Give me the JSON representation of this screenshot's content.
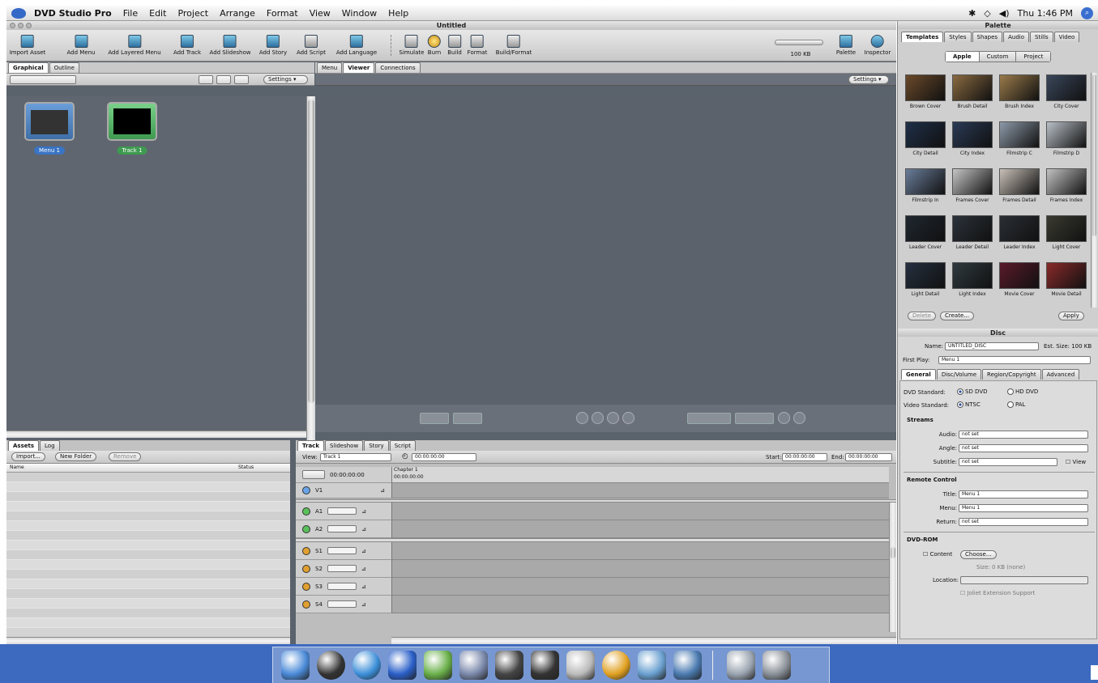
{
  "menubar": {
    "app_name": "DVD Studio Pro",
    "items": [
      "File",
      "Edit",
      "Project",
      "Arrange",
      "Format",
      "View",
      "Window",
      "Help"
    ],
    "clock": "Thu 1:46 PM"
  },
  "window": {
    "title": "Untitled"
  },
  "toolbar": {
    "items": [
      "Import Asset",
      "Add Menu",
      "Add Layered Menu",
      "Add Track",
      "Add Slideshow",
      "Add Story",
      "Add Script",
      "Add Language",
      "Simulate",
      "Burn",
      "Build",
      "Format",
      "Build/Format",
      "Palette",
      "Inspector"
    ],
    "disk_size": "100 KB"
  },
  "left_tabs": {
    "graphical": "Graphical",
    "outline": "Outline"
  },
  "left_subbar": {
    "settings": "Settings"
  },
  "graphical_items": [
    {
      "label": "Menu 1",
      "type": "menu",
      "accent": "#5a8fc8"
    },
    {
      "label": "Track 1",
      "type": "track",
      "accent": "#4fae5a"
    }
  ],
  "viewer_tabs": {
    "menu": "Menu",
    "viewer": "Viewer",
    "connections": "Connections"
  },
  "viewer_settings": "Settings",
  "bottom_left_tabs": {
    "assets": "Assets",
    "log": "Log"
  },
  "assets": {
    "import_btn": "Import...",
    "new_folder_btn": "New Folder",
    "remove_btn": "Remove",
    "col_name": "Name",
    "col_status": "Status"
  },
  "timeline_tabs": {
    "track": "Track",
    "slideshow": "Slideshow",
    "story": "Story",
    "script": "Script"
  },
  "timeline": {
    "view_label": "View:",
    "view_value": "Track 1",
    "timecode": "00:00:00:00",
    "start_label": "Start:",
    "start_value": "00:00:00:00",
    "end_label": "End:",
    "end_value": "00:00:00:00",
    "chapter_label": "Chapter 1",
    "chapter_time": "00:00:00:00",
    "head_time": "00:00:00:00",
    "tracks": [
      "V1",
      "A1",
      "A2",
      "S1",
      "S2",
      "S3",
      "S4"
    ]
  },
  "palette": {
    "title": "Palette",
    "tabs": [
      "Templates",
      "Styles",
      "Shapes",
      "Audio",
      "Stills",
      "Video"
    ],
    "subtabs": [
      "Apple",
      "Custom",
      "Project"
    ],
    "templates": [
      {
        "name": "Brown Cover",
        "color": "#6b4a2a"
      },
      {
        "name": "Brush Detail",
        "color": "#8a6a40"
      },
      {
        "name": "Brush Index",
        "color": "#9a7a4a"
      },
      {
        "name": "City Cover",
        "color": "#39465a"
      },
      {
        "name": "City Detail",
        "color": "#1f3048"
      },
      {
        "name": "City Index",
        "color": "#2a3a55"
      },
      {
        "name": "Filmstrip C",
        "color": "#8d9aa8"
      },
      {
        "name": "Filmstrip D",
        "color": "#b9c0c8"
      },
      {
        "name": "Filmstrip In",
        "color": "#6a7d9a"
      },
      {
        "name": "Frames Cover",
        "color": "#c6c6c6"
      },
      {
        "name": "Frames Detail",
        "color": "#c9c1b8"
      },
      {
        "name": "Frames Index",
        "color": "#c2c2c2"
      },
      {
        "name": "Leader Cover",
        "color": "#1f2730"
      },
      {
        "name": "Leader Detail",
        "color": "#2b323a"
      },
      {
        "name": "Leader Index",
        "color": "#2a2f35"
      },
      {
        "name": "Light Cover",
        "color": "#3a3a30"
      },
      {
        "name": "Light Detail",
        "color": "#253040"
      },
      {
        "name": "Light Index",
        "color": "#2f3a3f"
      },
      {
        "name": "Movie Cover",
        "color": "#5a1a2a"
      },
      {
        "name": "Movie Detail",
        "color": "#8a2a2a"
      }
    ],
    "delete_btn": "Delete",
    "create_btn": "Create...",
    "apply_btn": "Apply"
  },
  "inspector": {
    "title": "Disc",
    "name_label": "Name:",
    "name_value": "UNTITLED_DISC",
    "est_size": "Est. Size: 100 KB",
    "first_play_label": "First Play:",
    "first_play_value": "Menu 1",
    "tabs": [
      "General",
      "Disc/Volume",
      "Region/Copyright",
      "Advanced"
    ],
    "dvd_standard_label": "DVD Standard:",
    "sd_dvd": "SD DVD",
    "hd_dvd": "HD DVD",
    "video_standard_label": "Video Standard:",
    "ntsc": "NTSC",
    "pal": "PAL",
    "streams_title": "Streams",
    "audio_label": "Audio:",
    "audio_value": "not set",
    "angle_label": "Angle:",
    "angle_value": "not set",
    "subtitle_label": "Subtitle:",
    "subtitle_value": "not set",
    "view_label": "View",
    "remote_title": "Remote Control",
    "title_label": "Title:",
    "title_value": "Menu 1",
    "menu_label": "Menu:",
    "menu_value": "Menu 1",
    "return_label": "Return:",
    "return_value": "not set",
    "dvdrom_title": "DVD-ROM",
    "content_label": "Content",
    "choose_btn": "Choose...",
    "size_text": "Size: 0 KB (none)",
    "location_label": "Location:",
    "joliet": "Joliet Extension Support"
  },
  "dock": {
    "icons": [
      {
        "name": "finder",
        "color": "#4a8ad8"
      },
      {
        "name": "dashboard",
        "color": "#333"
      },
      {
        "name": "safari",
        "color": "#3a8ed8"
      },
      {
        "name": "word",
        "color": "#2a5fc8"
      },
      {
        "name": "itunes",
        "color": "#6ab04a"
      },
      {
        "name": "dvd-player",
        "color": "#7a88aa"
      },
      {
        "name": "imovie",
        "color": "#444"
      },
      {
        "name": "final-cut",
        "color": "#333"
      },
      {
        "name": "keynote",
        "color": "#bbb"
      },
      {
        "name": "dvd-studio-pro",
        "color": "#e0a020"
      },
      {
        "name": "preview",
        "color": "#6aa0d0"
      },
      {
        "name": "iphoto",
        "color": "#4a7ab0"
      },
      {
        "name": "mail",
        "color": "#9aa4b0"
      },
      {
        "name": "trash",
        "color": "#8a9098"
      }
    ]
  }
}
